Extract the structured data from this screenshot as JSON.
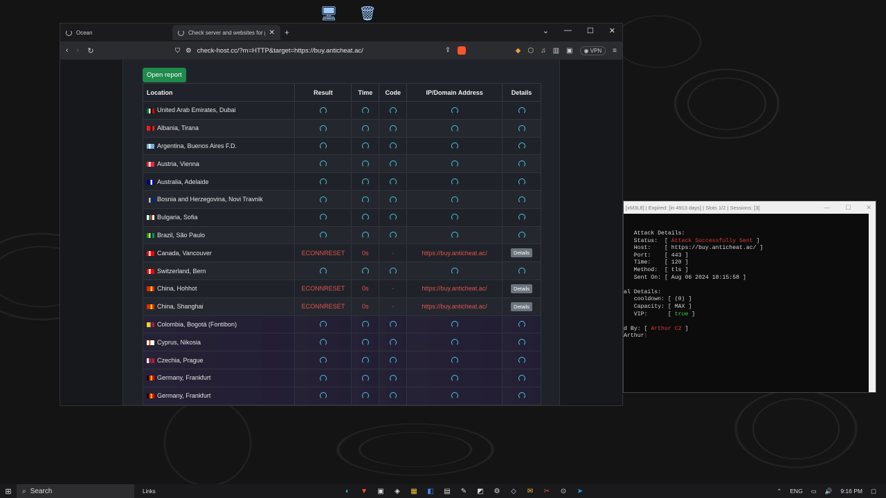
{
  "browser": {
    "tabs": [
      {
        "label": "Ocean",
        "active": false
      },
      {
        "label": "Check server and websites for p",
        "active": true
      }
    ],
    "url": "check-host.cc/?m=HTTP&target=https://buy.anticheat.ac/",
    "vpn_label": "VPN"
  },
  "page": {
    "open_report": "Open report",
    "headers": [
      "Location",
      "Result",
      "Time",
      "Code",
      "IP/Domain Address",
      "Details"
    ],
    "rows": [
      {
        "location": "United Arab Emirates, Dubai",
        "flag": [
          "#00732f",
          "#ffffff",
          "#000000",
          "#ff0000"
        ],
        "status": "loading"
      },
      {
        "location": "Albania, Tirana",
        "flag": [
          "#e41e20",
          "#e41e20",
          "#000000",
          "#e41e20"
        ],
        "status": "loading"
      },
      {
        "location": "Argentina, Buenos Aires F.D.",
        "flag": [
          "#74acdf",
          "#ffffff",
          "#74acdf",
          "#74acdf"
        ],
        "status": "loading"
      },
      {
        "location": "Austria, Vienna",
        "flag": [
          "#ed2939",
          "#ffffff",
          "#ed2939",
          "#ed2939"
        ],
        "status": "loading"
      },
      {
        "location": "Australia, Adelaide",
        "flag": [
          "#00008b",
          "#00008b",
          "#ffffff",
          "#00008b"
        ],
        "status": "loading"
      },
      {
        "location": "Bosnia and Herzegovina, Novi Travnik",
        "flag": [
          "#002395",
          "#fecb00",
          "#002395",
          "#002395"
        ],
        "status": "loading"
      },
      {
        "location": "Bulgaria, Sofia",
        "flag": [
          "#ffffff",
          "#00966e",
          "#d62612",
          "#ffffff"
        ],
        "status": "loading"
      },
      {
        "location": "Brazil, São Paulo",
        "flag": [
          "#009c3b",
          "#ffdf00",
          "#002776",
          "#009c3b"
        ],
        "status": "loading"
      },
      {
        "location": "Canada, Vancouver",
        "flag": [
          "#ff0000",
          "#ffffff",
          "#ff0000",
          "#ff0000"
        ],
        "status": "error",
        "result": "ECONNRESET",
        "time": "0s",
        "code": "-",
        "address": "https://buy.anticheat.ac/",
        "details": "Details"
      },
      {
        "location": "Switzerland, Bern",
        "flag": [
          "#ff0000",
          "#ffffff",
          "#ff0000",
          "#ff0000"
        ],
        "status": "loading"
      },
      {
        "location": "China, Hohhot",
        "flag": [
          "#de2910",
          "#de2910",
          "#ffde00",
          "#de2910"
        ],
        "status": "error",
        "result": "ECONNRESET",
        "time": "0s",
        "code": "-",
        "address": "https://buy.anticheat.ac/",
        "details": "Details"
      },
      {
        "location": "China, Shanghai",
        "flag": [
          "#de2910",
          "#de2910",
          "#ffde00",
          "#de2910"
        ],
        "status": "error",
        "result": "ECONNRESET",
        "time": "0s",
        "code": "-",
        "address": "https://buy.anticheat.ac/",
        "details": "Details"
      },
      {
        "location": "Colombia, Bogotá (Fontibon)",
        "flag": [
          "#fcd116",
          "#fcd116",
          "#003893",
          "#ce1126"
        ],
        "status": "loading"
      },
      {
        "location": "Cyprus, Nikosia",
        "flag": [
          "#ffffff",
          "#d47600",
          "#ffffff",
          "#ffffff"
        ],
        "status": "loading"
      },
      {
        "location": "Czechia, Prague",
        "flag": [
          "#ffffff",
          "#d7141a",
          "#11457e",
          "#d7141a"
        ],
        "status": "loading"
      },
      {
        "location": "Germany, Frankfurt",
        "flag": [
          "#000000",
          "#dd0000",
          "#ffce00",
          "#dd0000"
        ],
        "status": "loading"
      },
      {
        "location": "Germany, Frankfurt",
        "flag": [
          "#000000",
          "#dd0000",
          "#ffce00",
          "#dd0000"
        ],
        "status": "loading"
      }
    ]
  },
  "terminal": {
    "title": "[xM3L8] | Expired: [in 4913 days] | Slots 1/2 | Sessions: [3]",
    "lines": [
      [
        {
          "t": "   Attack Details:"
        }
      ],
      [
        {
          "t": "   Status:  [ "
        },
        {
          "t": "Attack Successfully Sent",
          "c": "red"
        },
        {
          "t": " ]"
        }
      ],
      [
        {
          "t": "   Host:    [ https://buy.anticheat.ac/ ]"
        }
      ],
      [
        {
          "t": "   Port:    [ 443 ]"
        }
      ],
      [
        {
          "t": "   Time:    [ 120 ]"
        }
      ],
      [
        {
          "t": "   Method:  [ tls ]"
        }
      ],
      [
        {
          "t": "   Sent On: [ Aug 06 2024 18:15:58 ]"
        }
      ],
      [
        {
          "t": ""
        }
      ],
      [
        {
          "t": "al Details:"
        }
      ],
      [
        {
          "t": "   cooldown: [ (0) ]"
        }
      ],
      [
        {
          "t": "   Capacity: [ MAX ]"
        }
      ],
      [
        {
          "t": "   VIP:      [ "
        },
        {
          "t": "true",
          "c": "green"
        },
        {
          "t": " ]"
        }
      ],
      [
        {
          "t": ""
        }
      ],
      [
        {
          "t": "d By: [ "
        },
        {
          "t": "Arthur C2",
          "c": "red"
        },
        {
          "t": " ]"
        }
      ],
      [
        {
          "t": "Arthur"
        },
        {
          "t": "|",
          "c": "red"
        }
      ]
    ]
  },
  "taskbar": {
    "search_placeholder": "Search",
    "links": "Links",
    "lang": "ENG",
    "time": "9:16 PM"
  },
  "colors": {
    "accent_loader": "#49c6e5",
    "error": "#e0524f",
    "open_report_bg": "#1f8a4c"
  }
}
